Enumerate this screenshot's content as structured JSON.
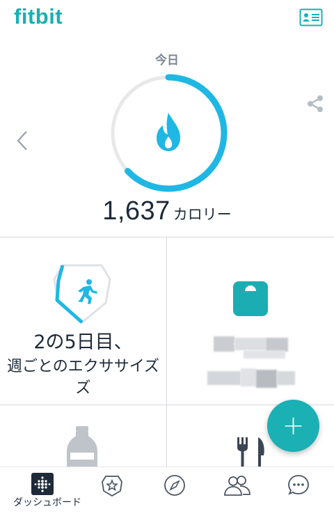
{
  "app": {
    "logo": "fitbit",
    "accent_color": "#19b0b3",
    "ring_color": "#1fb7e4"
  },
  "header": {
    "profile_icon": "profile-card-icon"
  },
  "hero": {
    "day_label": "今日",
    "calories_value": "1,637",
    "calories_unit": "カロリー",
    "ring_progress": 0.63,
    "share_icon": "share-icon",
    "prev_icon": "chevron-left-icon"
  },
  "tiles": {
    "exercise": {
      "title": "2の5日目、",
      "subtitle_line1": "週ごとのエクササイズ",
      "subtitle_line2": "ズ",
      "icon": "exercise-shield-icon"
    },
    "weight": {
      "icon": "scale-icon"
    },
    "water": {
      "icon": "water-bottle-icon"
    },
    "food": {
      "icon": "fork-knife-icon"
    }
  },
  "fab": {
    "label": "+"
  },
  "nav": {
    "items": [
      {
        "label": "ダッシュボード",
        "icon": "dashboard-icon",
        "active": true
      },
      {
        "label": "",
        "icon": "challenges-star-icon",
        "active": false
      },
      {
        "label": "",
        "icon": "compass-icon",
        "active": false
      },
      {
        "label": "",
        "icon": "community-icon",
        "active": false
      },
      {
        "label": "",
        "icon": "messages-icon",
        "active": false
      }
    ]
  }
}
